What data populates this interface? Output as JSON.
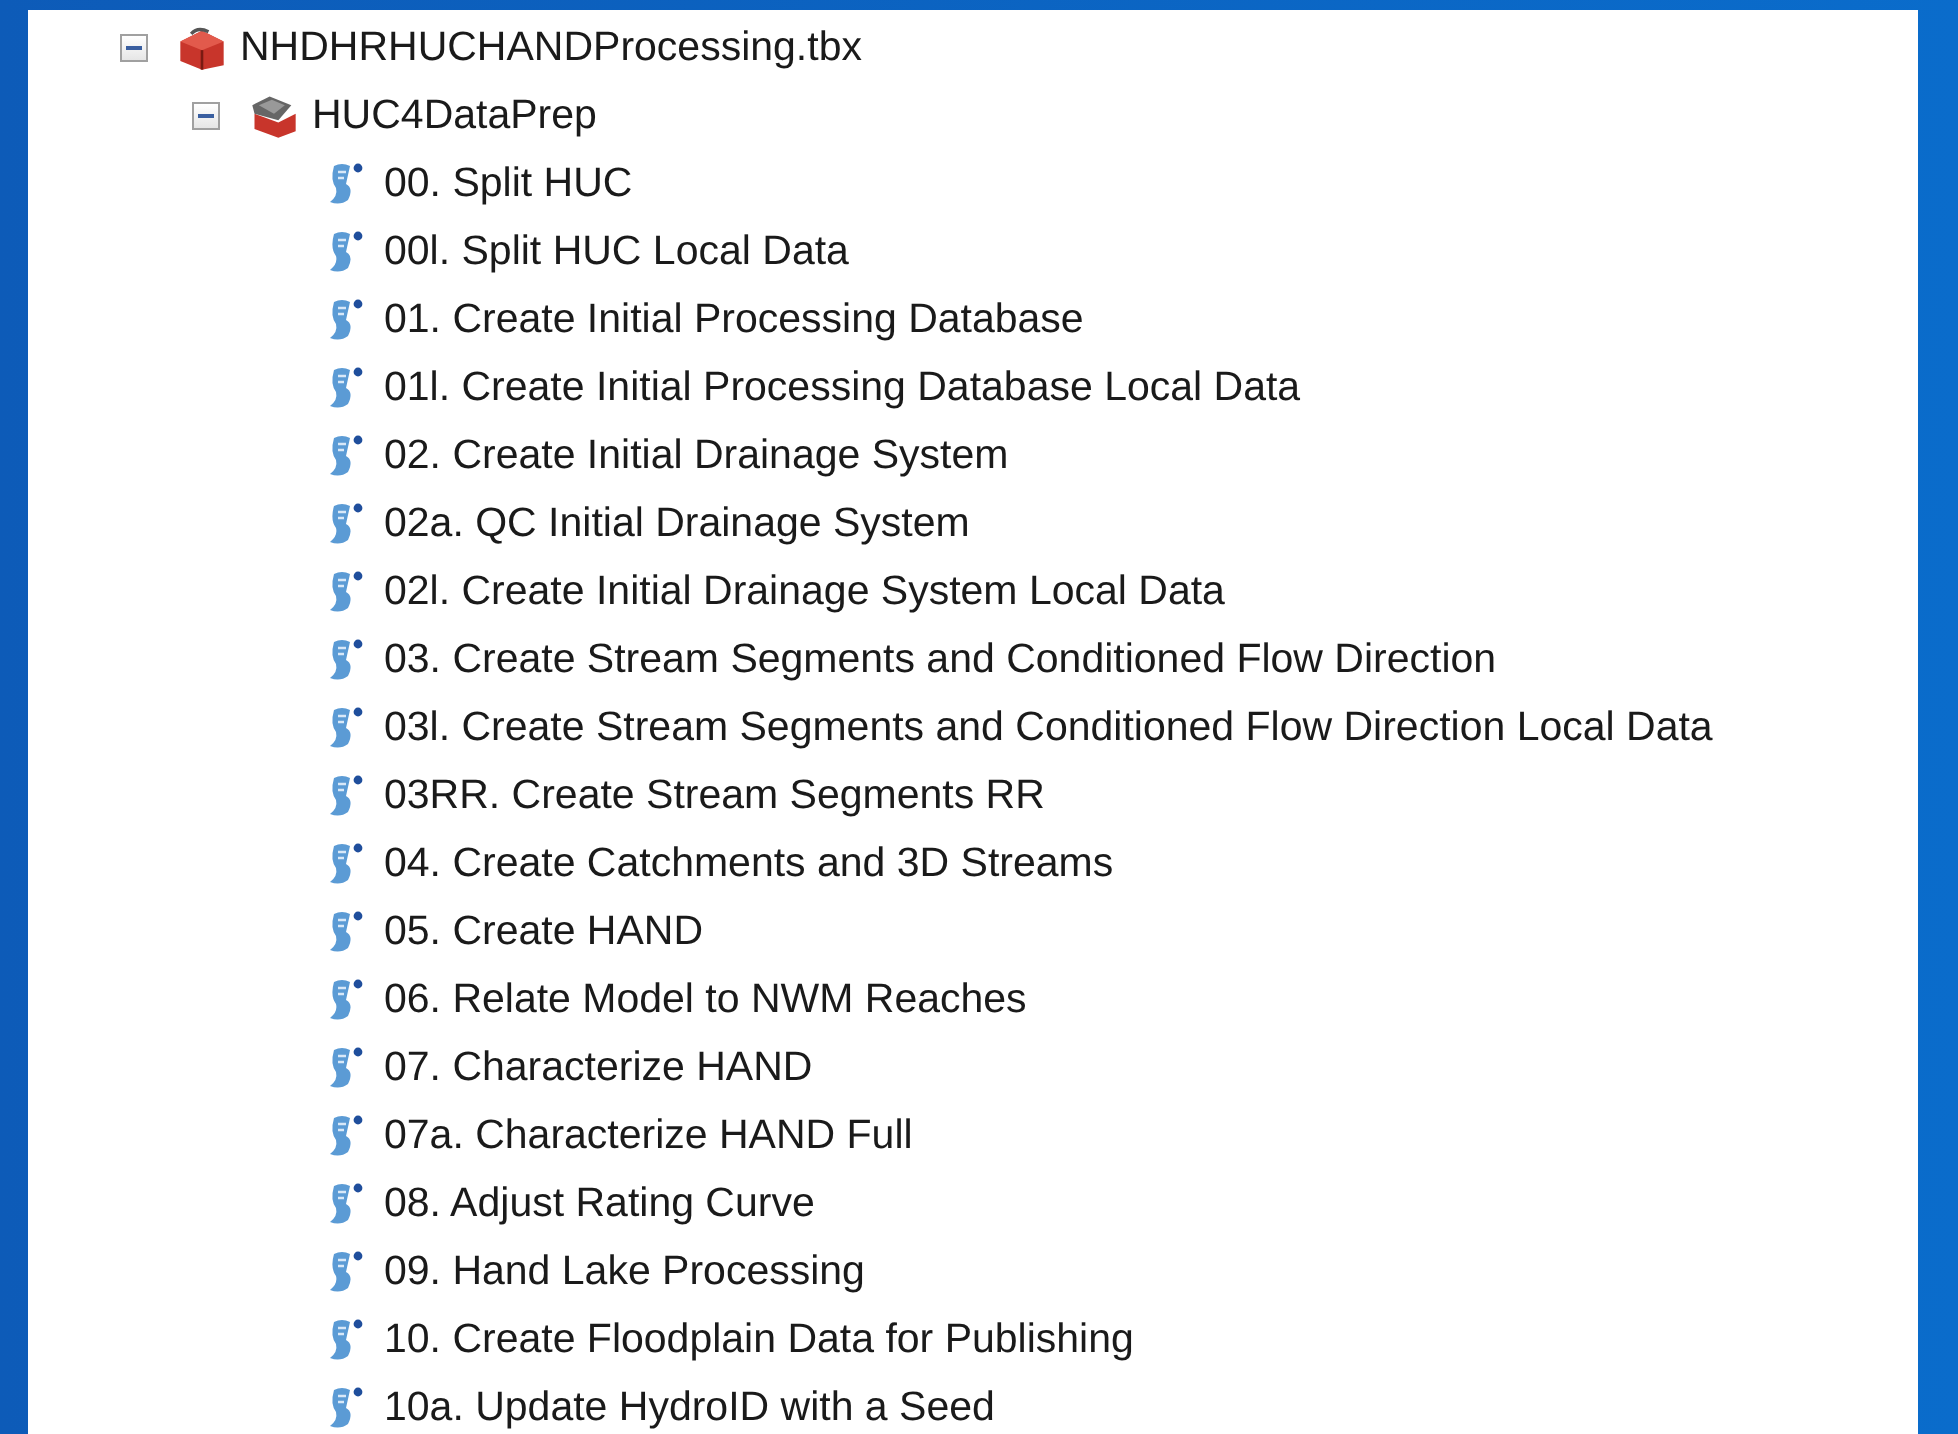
{
  "tree": [
    {
      "kind": "toolbox",
      "label": "NHDHRHUCHANDProcessing.tbx",
      "expanded": true,
      "children": [
        {
          "kind": "toolset",
          "label": "HUC4DataPrep",
          "expanded": true,
          "children": [
            {
              "kind": "tool",
              "label": "00. Split HUC"
            },
            {
              "kind": "tool",
              "label": "00l. Split HUC Local Data"
            },
            {
              "kind": "tool",
              "label": "01. Create Initial Processing Database"
            },
            {
              "kind": "tool",
              "label": "01l. Create Initial Processing Database Local Data"
            },
            {
              "kind": "tool",
              "label": "02. Create Initial Drainage System"
            },
            {
              "kind": "tool",
              "label": "02a. QC Initial Drainage System"
            },
            {
              "kind": "tool",
              "label": "02l. Create Initial Drainage System Local Data"
            },
            {
              "kind": "tool",
              "label": "03. Create Stream Segments and Conditioned Flow Direction"
            },
            {
              "kind": "tool",
              "label": "03l. Create Stream Segments and Conditioned Flow Direction Local Data"
            },
            {
              "kind": "tool",
              "label": "03RR. Create Stream Segments RR"
            },
            {
              "kind": "tool",
              "label": "04. Create Catchments and 3D Streams"
            },
            {
              "kind": "tool",
              "label": "05. Create HAND"
            },
            {
              "kind": "tool",
              "label": "06. Relate Model to NWM Reaches"
            },
            {
              "kind": "tool",
              "label": "07. Characterize HAND"
            },
            {
              "kind": "tool",
              "label": "07a. Characterize HAND Full"
            },
            {
              "kind": "tool",
              "label": "08. Adjust Rating Curve"
            },
            {
              "kind": "tool",
              "label": "09. Hand Lake Processing"
            },
            {
              "kind": "tool",
              "label": "10. Create Floodplain Data for Publishing"
            },
            {
              "kind": "tool",
              "label": "10a. Update HydroID with a Seed"
            }
          ]
        }
      ]
    }
  ]
}
